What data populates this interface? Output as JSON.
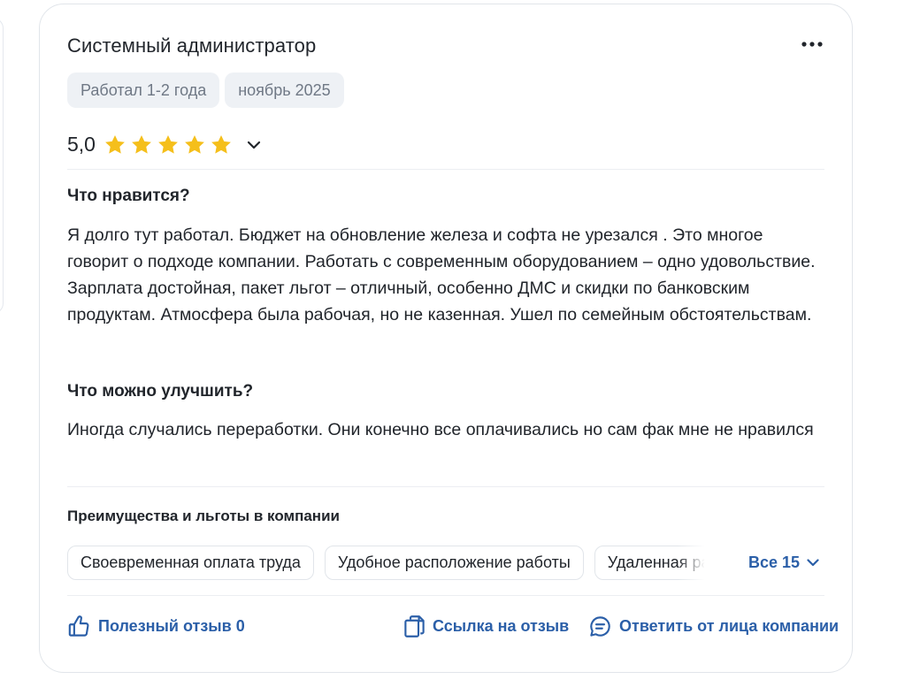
{
  "review": {
    "title": "Системный администратор",
    "tags": [
      "Работал 1-2 года",
      "ноябрь 2025"
    ],
    "rating": {
      "value": "5,0",
      "stars": 5,
      "max": 5,
      "star_color": "#f5bf1b"
    },
    "likes": {
      "heading": "Что нравится?",
      "text": "Я долго тут работал. Бюджет на обновление железа и софта не урезался . Это многое говорит о подходе компании. Работать с современным оборудованием – одно удовольствие. Зарплата достойная, пакет льгот – отличный, особенно ДМС и скидки по банковским продуктам. Атмосфера была рабочая, но не казенная. Ушел по семейным обстоятельствам."
    },
    "improve": {
      "heading": "Что можно улучшить?",
      "text": "Иногда случались переработки. Они конечно все оплачивались но сам фак мне не нравился"
    },
    "benefits": {
      "heading": "Преимущества и льготы в компании",
      "items": [
        "Своевременная оплата труда",
        "Удобное расположение работы",
        "Удаленная работа"
      ],
      "all_label": "Все 15"
    },
    "actions": {
      "helpful": "Полезный отзыв 0",
      "link": "Ссылка на отзыв",
      "reply": "Ответить от лица компании"
    },
    "icons": {
      "more": "more-dots-icon",
      "chevron": "chevron-down-icon",
      "helpful": "thumbs-up-icon",
      "link": "copy-icon",
      "reply": "chat-bubble-icon"
    },
    "colors": {
      "accent": "#2b5fa8",
      "text": "#21252b",
      "muted": "#6f7885",
      "tag_bg": "#eef1f5"
    }
  }
}
